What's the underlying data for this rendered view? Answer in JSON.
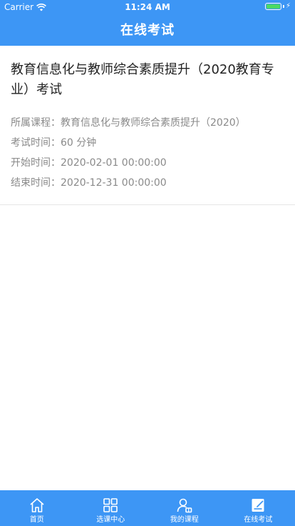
{
  "status_bar": {
    "carrier": "Carrier",
    "time": "11:24 AM"
  },
  "nav": {
    "title": "在线考试"
  },
  "exam": {
    "title": "教育信息化与教师综合素质提升（2020教育专业）考试",
    "course_line": "所属课程：教育信息化与教师综合素质提升（2020）",
    "duration_line": "考试时间：60 分钟",
    "start_line": "开始时间：2020-02-01 00:00:00",
    "end_line": "结束时间：2020-12-31 00:00:00"
  },
  "tabs": [
    {
      "label": "首页",
      "icon": "home-icon"
    },
    {
      "label": "选课中心",
      "icon": "grid-icon"
    },
    {
      "label": "我的课程",
      "icon": "user-icon"
    },
    {
      "label": "在线考试",
      "icon": "exam-icon"
    }
  ],
  "colors": {
    "brand_blue": "#3d96f5",
    "battery_green": "#4cd964"
  }
}
